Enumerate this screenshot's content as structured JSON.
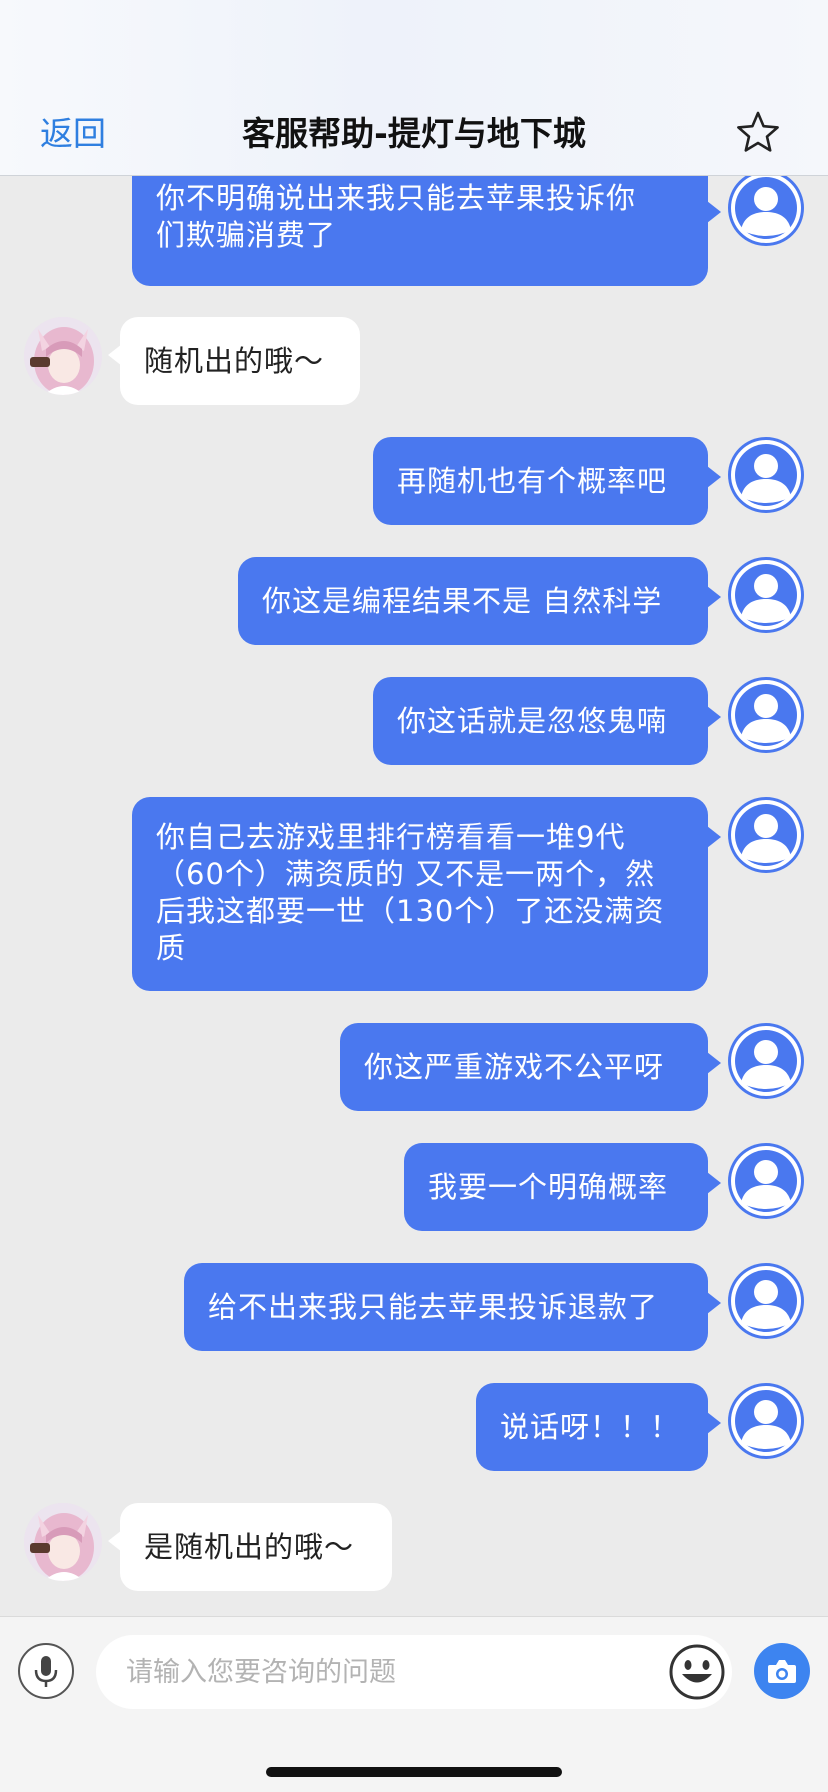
{
  "header": {
    "back_label": "返回",
    "title": "客服帮助-提灯与地下城",
    "favorite_icon": "star-outline-icon"
  },
  "messages": [
    {
      "sender": "user",
      "lines": [
        "你不明确说出来我只能去苹果投诉你",
        "们欺骗消费了"
      ]
    },
    {
      "sender": "agent",
      "text": "随机出的哦～"
    },
    {
      "sender": "user",
      "text": "再随机也有个概率吧"
    },
    {
      "sender": "user",
      "text": "你这是编程结果不是 自然科学"
    },
    {
      "sender": "user",
      "text": "你这话就是忽悠鬼喃"
    },
    {
      "sender": "user",
      "lines": [
        "你自己去游戏里排行榜看看一堆9代",
        "（60个）满资质的 又不是一两个，然",
        "后我这都要一世（130个）了还没满资",
        "质"
      ]
    },
    {
      "sender": "user",
      "text": "你这严重游戏不公平呀"
    },
    {
      "sender": "user",
      "text": "我要一个明确概率"
    },
    {
      "sender": "user",
      "text": "给不出来我只能去苹果投诉退款了"
    },
    {
      "sender": "user",
      "text": "说话呀！！！"
    },
    {
      "sender": "agent",
      "text": "是随机出的哦～"
    }
  ],
  "input": {
    "placeholder": "请输入您要咨询的问题",
    "mic_icon": "microphone-icon",
    "emoji_icon": "emoji-icon",
    "camera_icon": "camera-icon"
  },
  "colors": {
    "user_bubble": "#4a78ef",
    "agent_bubble": "#ffffff",
    "background": "#ebebeb",
    "accent": "#2f7fe0"
  }
}
